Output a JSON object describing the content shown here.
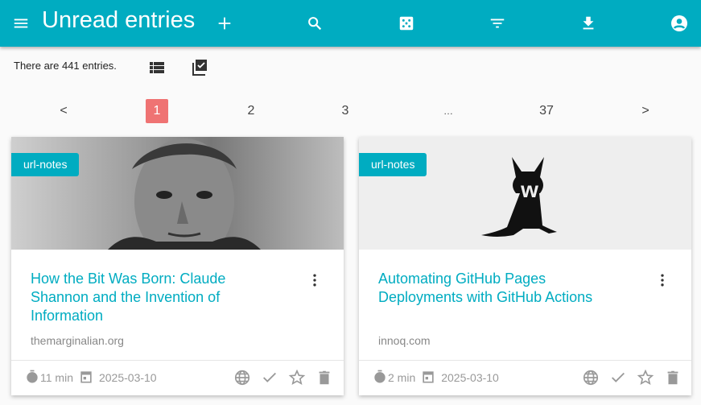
{
  "header": {
    "title": "Unread entries",
    "icons": [
      "menu-icon",
      "add-icon",
      "search-icon",
      "random-dice-icon",
      "filter-icon",
      "download-icon",
      "account-icon"
    ],
    "color": "#00acc1"
  },
  "toolbar": {
    "count_text": "There are 441 entries."
  },
  "pagination": {
    "prev": "<",
    "pages": [
      "1",
      "2",
      "3",
      "…",
      "37"
    ],
    "next": ">",
    "active": "1"
  },
  "entries": [
    {
      "tag": "url-notes",
      "title": "How the Bit Was Born: Claude Shannon and the Invention of Information",
      "domain": "themarginalian.org",
      "reading_time": "11 min",
      "date": "2025-03-10"
    },
    {
      "tag": "url-notes",
      "title": "Automating GitHub Pages Deployments with GitHub Actions",
      "domain": "innoq.com",
      "reading_time": "2 min",
      "date": "2025-03-10"
    }
  ]
}
